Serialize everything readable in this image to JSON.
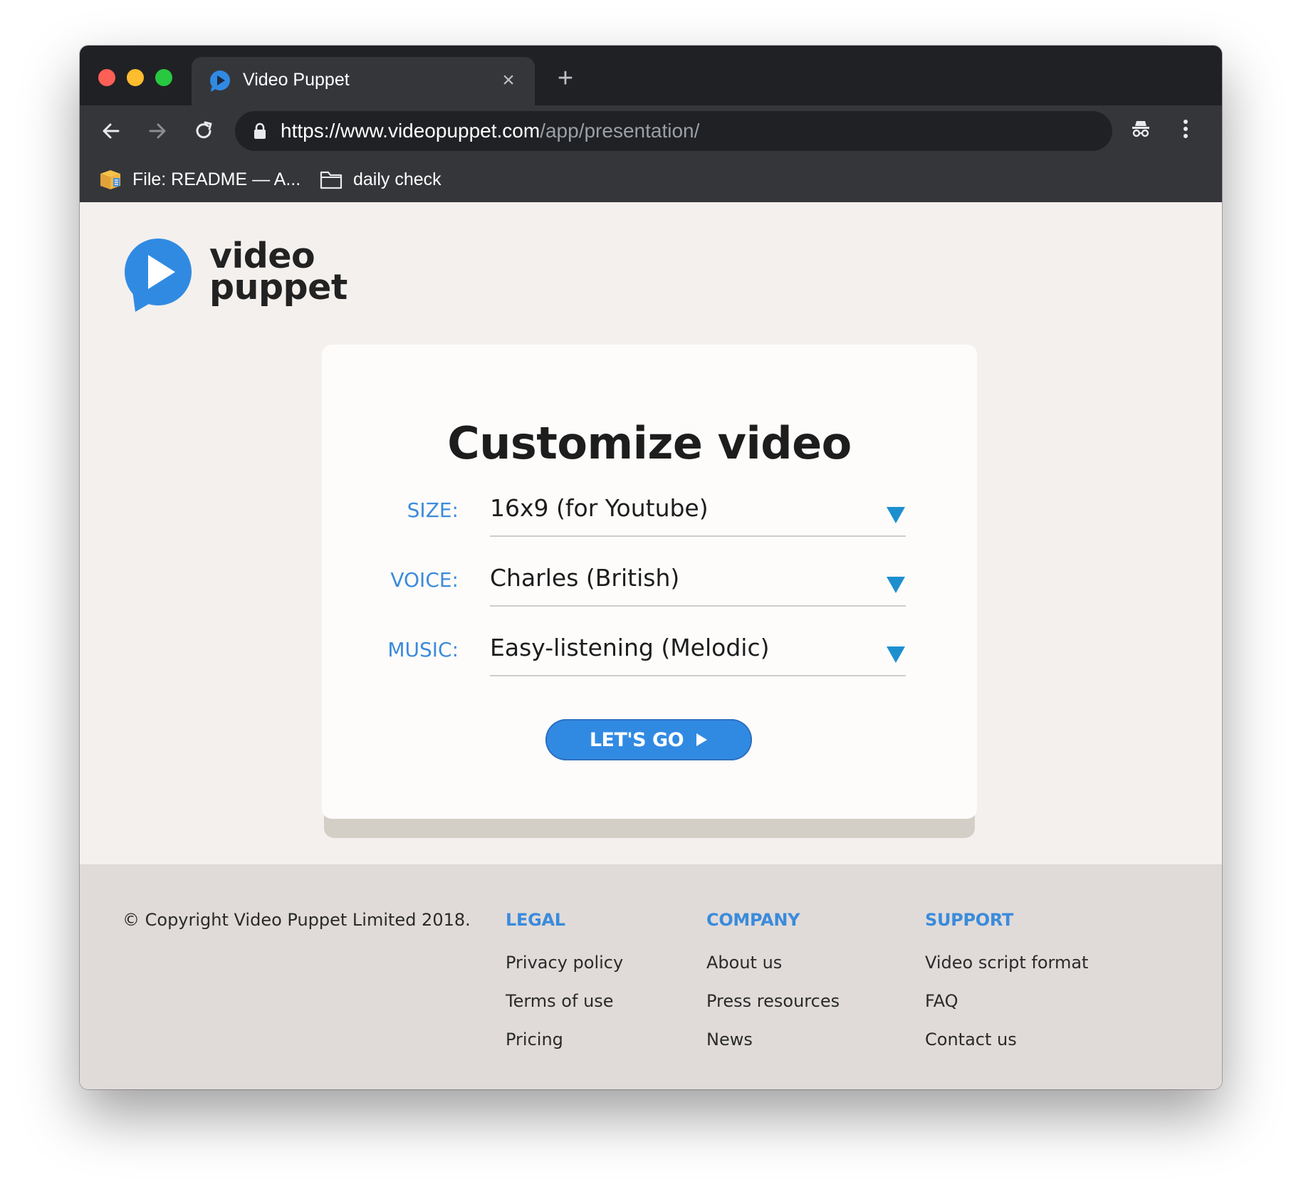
{
  "browser": {
    "tab_title": "Video Puppet",
    "tab_close": "×",
    "new_tab": "+",
    "url_host": "https://www.videopuppet.com",
    "url_path": "/app/presentation/",
    "bookmarks": [
      {
        "label": "File: README — A...",
        "icon": "box-icon"
      },
      {
        "label": "daily check",
        "icon": "folder-icon"
      }
    ]
  },
  "logo": {
    "line1": "video",
    "line2": "puppet",
    "color": "#318ae2"
  },
  "card": {
    "title": "Customize video",
    "fields": [
      {
        "label": "SIZE:",
        "value": "16x9 (for Youtube)"
      },
      {
        "label": "VOICE:",
        "value": "Charles (British)"
      },
      {
        "label": "MUSIC:",
        "value": "Easy-listening (Melodic)"
      }
    ],
    "button_label": "LET'S GO",
    "accent_color": "#3b8bdb",
    "caret_color": "#1d8fcf"
  },
  "footer": {
    "copyright": "© Copyright Video Puppet Limited 2018.",
    "columns": [
      {
        "heading": "LEGAL",
        "links": [
          "Privacy policy",
          "Terms of use",
          "Pricing"
        ]
      },
      {
        "heading": "COMPANY",
        "links": [
          "About us",
          "Press resources",
          "News"
        ]
      },
      {
        "heading": "SUPPORT",
        "links": [
          "Video script format",
          "FAQ",
          "Contact us"
        ]
      }
    ]
  }
}
